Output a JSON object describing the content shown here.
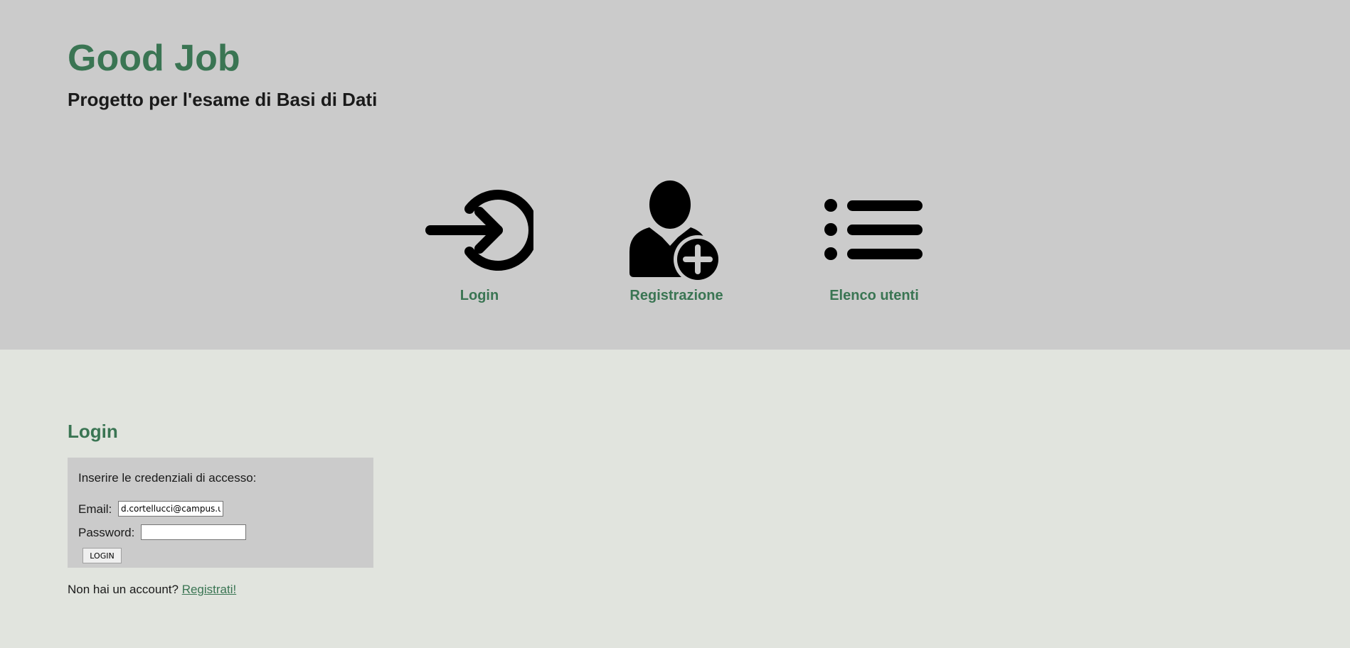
{
  "header": {
    "title": "Good Job",
    "subtitle": "Progetto per l'esame di Basi di Dati"
  },
  "nav": {
    "items": [
      {
        "label": "Login",
        "icon": "login-icon"
      },
      {
        "label": "Registrazione",
        "icon": "add-user-icon"
      },
      {
        "label": "Elenco utenti",
        "icon": "list-icon"
      }
    ]
  },
  "login": {
    "title": "Login",
    "intro": "Inserire le credenziali di accesso:",
    "email_label": "Email:",
    "email_value": "d.cortellucci@campus.un",
    "password_label": "Password:",
    "password_value": "",
    "button_label": "LOGIN",
    "signup_prompt": "Non hai un account?",
    "signup_link": "Registrati!"
  },
  "colors": {
    "header_bg": "#cbcbcb",
    "page_bg": "#e1e4de",
    "accent": "#3a7553"
  }
}
